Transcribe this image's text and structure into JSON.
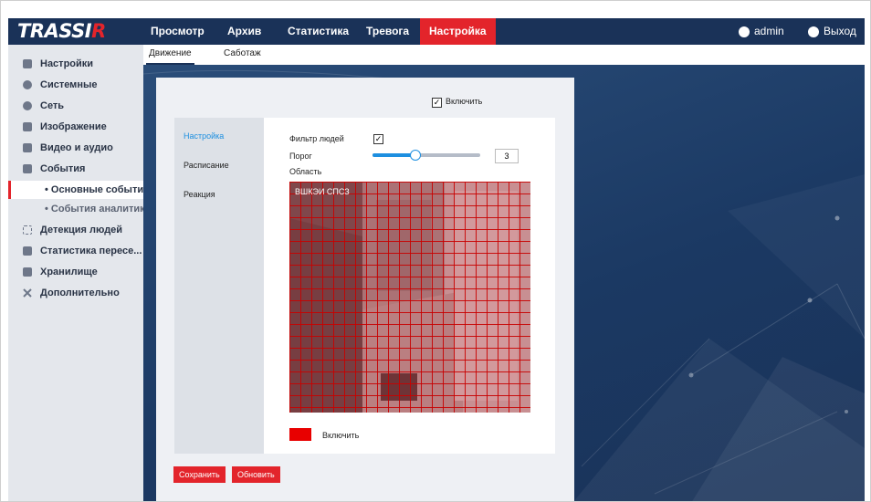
{
  "brand": {
    "logo_main": "TRASSI",
    "logo_accent": "R"
  },
  "nav": {
    "items": [
      "Просмотр",
      "Архив",
      "Статистика",
      "Тревога",
      "Настройка"
    ],
    "active": "Настройка"
  },
  "user": {
    "name": "admin",
    "logout": "Выход"
  },
  "sidebar": {
    "items": [
      "Настройки",
      "Системные",
      "Сеть",
      "Изображение",
      "Видео и аудио",
      "События"
    ],
    "sub": [
      "• Основные события",
      "• События аналитики"
    ],
    "items2": [
      "Детекция людей",
      "Статистика пересе...",
      "Хранилище",
      "Дополнительно"
    ]
  },
  "tabs": {
    "motion": "Движение",
    "sabotage": "Саботаж"
  },
  "panel": {
    "enable_top": "Включить",
    "left_tabs": [
      "Настройка",
      "Расписание",
      "Реакция"
    ],
    "filter_label": "Фильтр людей",
    "threshold_label": "Порог",
    "threshold_value": "3",
    "threshold_fraction": 0.4,
    "area_label": "Область",
    "enable_bottom": "Включить",
    "video_overlay": "ВШКЭИ СПСЗ"
  },
  "buttons": {
    "save": "Сохранить",
    "refresh": "Обновить"
  },
  "colors": {
    "nav_bg": "#1a3258",
    "accent_red": "#e3242b",
    "active_link": "#1d8fe0"
  }
}
